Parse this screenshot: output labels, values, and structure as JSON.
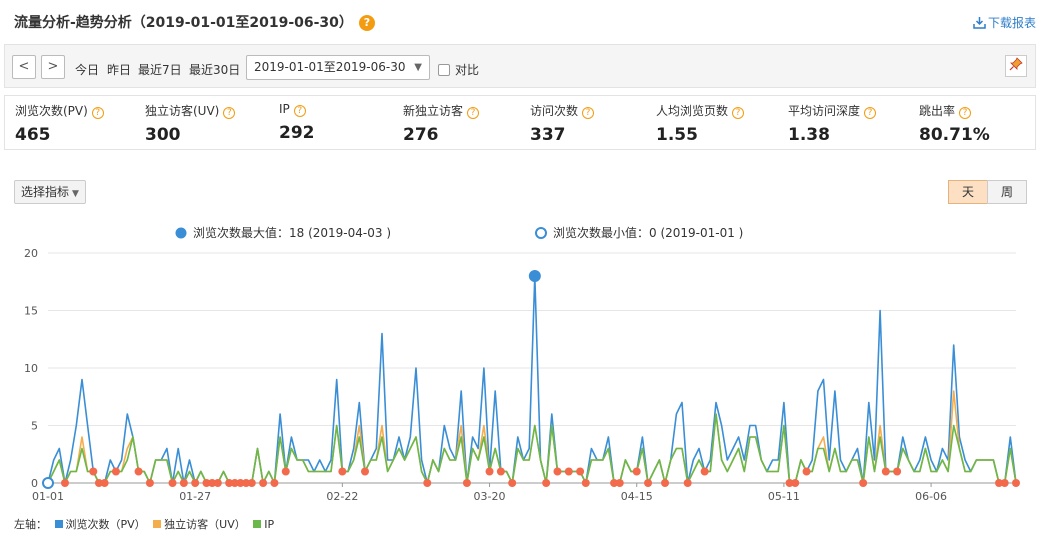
{
  "header": {
    "title": "流量分析-趋势分析（2019-01-01至2019-06-30）",
    "help": "?",
    "download_label": "下载报表"
  },
  "toolbar": {
    "prev": "<",
    "next": ">",
    "quick_ranges": [
      "今日",
      "昨日",
      "最近7日",
      "最近30日"
    ],
    "date_range": "2019-01-01至2019-06-30",
    "compare_label": "对比"
  },
  "metrics": [
    {
      "label": "浏览次数(PV)",
      "value": "465"
    },
    {
      "label": "独立访客(UV)",
      "value": "300"
    },
    {
      "label": "IP",
      "value": "292"
    },
    {
      "label": "新独立访客",
      "value": "276"
    },
    {
      "label": "访问次数",
      "value": "337"
    },
    {
      "label": "人均浏览页数",
      "value": "1.55"
    },
    {
      "label": "平均访问深度",
      "value": "1.38"
    },
    {
      "label": "跳出率",
      "value": "80.71%"
    }
  ],
  "controls": {
    "selector_label": "选择指标",
    "day_label": "天",
    "week_label": "周"
  },
  "annotations": {
    "max_label": "浏览次数最大值：18 (2019-04-03 )",
    "min_label": "浏览次数最小值：0 (2019-01-01 )"
  },
  "legend": {
    "axis_label": "左轴：",
    "items": [
      "浏览次数（PV）",
      "独立访客（UV）",
      "IP"
    ]
  },
  "colors": {
    "pv": "#3a8ed6",
    "uv": "#f4ad4c",
    "ip": "#6ab84a",
    "zero_marker": "#f26a4b"
  },
  "chart_data": {
    "type": "line",
    "ylim": [
      0,
      20
    ],
    "yticks": [
      0,
      5,
      10,
      15,
      20
    ],
    "xtick_labels": [
      "01-01",
      "01-27",
      "02-22",
      "03-20",
      "04-15",
      "05-11",
      "06-06"
    ],
    "x_start": "2019-01-01",
    "x_end": "2019-06-30",
    "series": [
      {
        "name": "浏览次数（PV）",
        "values": [
          0,
          2,
          3,
          0,
          2,
          5,
          9,
          5,
          1,
          0,
          0,
          2,
          1,
          2,
          6,
          4,
          1,
          1,
          0,
          2,
          2,
          3,
          0,
          3,
          0,
          2,
          0,
          1,
          0,
          0,
          0,
          1,
          0,
          0,
          0,
          0,
          0,
          3,
          0,
          1,
          0,
          6,
          1,
          4,
          2,
          2,
          2,
          1,
          2,
          1,
          2,
          9,
          1,
          1,
          3,
          7,
          1,
          2,
          3,
          13,
          2,
          2,
          4,
          2,
          4,
          10,
          2,
          0,
          2,
          1,
          5,
          3,
          2,
          8,
          0,
          4,
          3,
          10,
          1,
          8,
          1,
          1,
          0,
          4,
          2,
          3,
          18,
          2,
          0,
          6,
          1,
          1,
          1,
          1,
          1,
          0,
          3,
          2,
          2,
          4,
          0,
          0,
          2,
          1,
          1,
          4,
          0,
          1,
          2,
          0,
          2,
          6,
          7,
          0,
          2,
          3,
          1,
          2,
          7,
          5,
          2,
          3,
          4,
          2,
          5,
          5,
          2,
          1,
          2,
          2,
          7,
          0,
          0,
          2,
          1,
          2,
          8,
          9,
          2,
          8,
          2,
          1,
          2,
          3,
          0,
          7,
          2,
          15,
          1,
          1,
          1,
          4,
          2,
          1,
          2,
          4,
          2,
          1,
          3,
          2,
          12,
          4,
          2,
          1,
          2,
          2,
          2,
          2,
          0,
          0,
          4,
          0
        ]
      },
      {
        "name": "独立访客（UV）",
        "values": [
          0,
          1,
          2,
          0,
          1,
          1,
          4,
          1,
          1,
          0,
          0,
          1,
          1,
          1,
          3,
          4,
          1,
          1,
          0,
          2,
          2,
          2,
          0,
          1,
          0,
          1,
          0,
          1,
          0,
          0,
          0,
          1,
          0,
          0,
          0,
          0,
          0,
          3,
          0,
          1,
          0,
          4,
          1,
          3,
          2,
          2,
          1,
          1,
          1,
          1,
          1,
          5,
          1,
          1,
          2,
          5,
          1,
          2,
          2,
          5,
          1,
          2,
          3,
          2,
          3,
          4,
          1,
          0,
          2,
          1,
          3,
          2,
          2,
          5,
          0,
          3,
          2,
          5,
          1,
          3,
          1,
          1,
          0,
          3,
          2,
          2,
          5,
          2,
          0,
          5,
          1,
          1,
          1,
          1,
          1,
          0,
          2,
          2,
          2,
          3,
          0,
          0,
          2,
          1,
          1,
          3,
          0,
          1,
          2,
          0,
          2,
          3,
          3,
          0,
          1,
          2,
          1,
          1,
          6,
          2,
          1,
          2,
          3,
          1,
          4,
          4,
          2,
          1,
          1,
          1,
          5,
          0,
          0,
          2,
          1,
          1,
          3,
          4,
          1,
          3,
          1,
          1,
          2,
          2,
          0,
          4,
          1,
          5,
          1,
          1,
          1,
          3,
          2,
          1,
          1,
          3,
          1,
          1,
          2,
          1,
          8,
          3,
          1,
          1,
          2,
          2,
          2,
          2,
          0,
          0,
          3,
          0
        ]
      },
      {
        "name": "IP",
        "values": [
          0,
          1,
          2,
          0,
          1,
          1,
          3,
          1,
          1,
          0,
          0,
          1,
          1,
          1,
          2,
          4,
          1,
          1,
          0,
          2,
          2,
          2,
          0,
          1,
          0,
          1,
          0,
          1,
          0,
          0,
          0,
          1,
          0,
          0,
          0,
          0,
          0,
          3,
          0,
          1,
          0,
          4,
          1,
          3,
          2,
          2,
          1,
          1,
          1,
          1,
          1,
          5,
          1,
          1,
          2,
          4,
          1,
          2,
          2,
          4,
          1,
          2,
          3,
          2,
          3,
          4,
          1,
          0,
          2,
          1,
          3,
          2,
          2,
          4,
          0,
          3,
          2,
          4,
          1,
          3,
          1,
          1,
          0,
          3,
          2,
          2,
          5,
          2,
          0,
          5,
          1,
          1,
          1,
          1,
          1,
          0,
          2,
          2,
          2,
          3,
          0,
          0,
          2,
          1,
          1,
          3,
          0,
          1,
          2,
          0,
          2,
          3,
          3,
          0,
          1,
          2,
          1,
          1,
          6,
          2,
          1,
          2,
          3,
          1,
          4,
          4,
          2,
          1,
          1,
          1,
          5,
          0,
          0,
          2,
          1,
          1,
          3,
          3,
          1,
          3,
          1,
          1,
          2,
          2,
          0,
          4,
          1,
          4,
          1,
          1,
          1,
          3,
          2,
          1,
          1,
          3,
          1,
          1,
          2,
          1,
          5,
          3,
          1,
          1,
          2,
          2,
          2,
          2,
          0,
          0,
          3,
          0
        ]
      }
    ]
  }
}
